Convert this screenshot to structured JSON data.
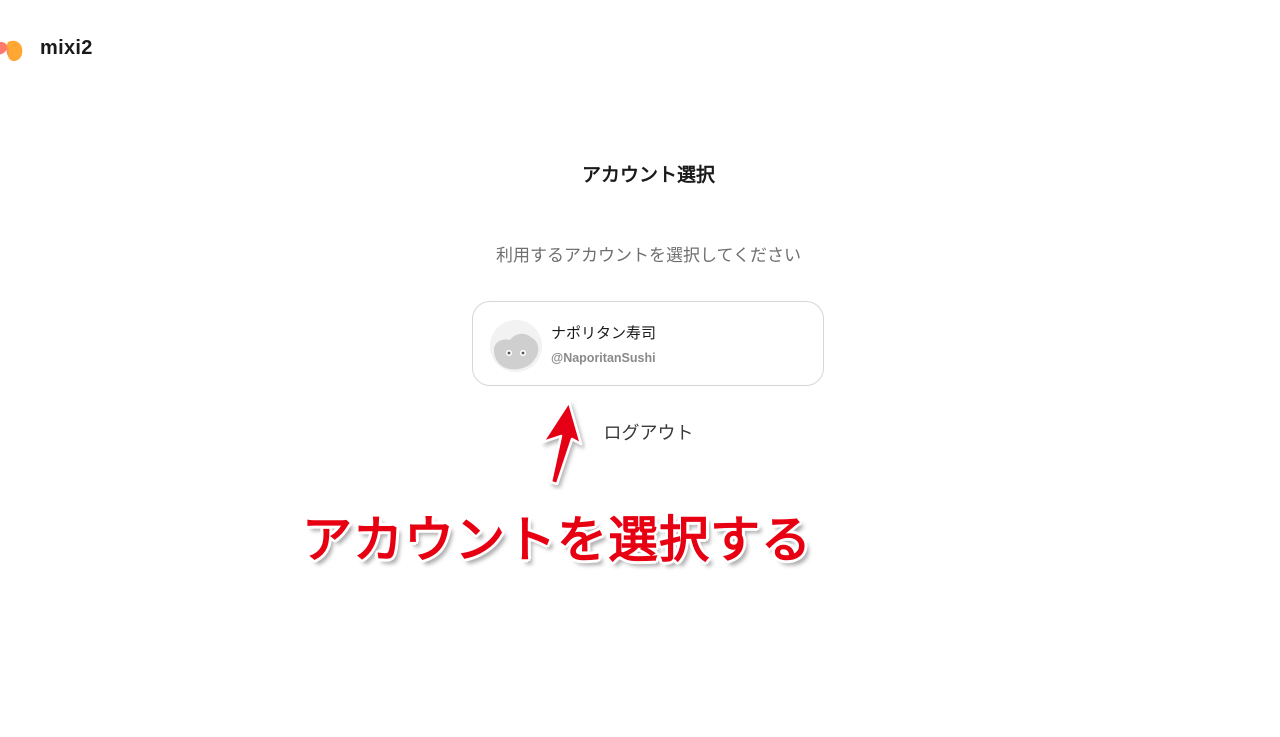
{
  "brand": {
    "name": "mixi2",
    "logo_icon": "mixi2-logo-icon",
    "logo_colors": [
      "#ff6f61",
      "#ffb03a"
    ]
  },
  "page": {
    "title": "アカウント選択",
    "subtitle": "利用するアカウントを選択してください"
  },
  "account": {
    "display_name": "ナポリタン寿司",
    "handle": "@NaporitanSushi",
    "avatar_icon": "default-avatar-icon"
  },
  "logout": {
    "label": "ログアウト"
  },
  "annotation": {
    "text": "アカウントを選択する",
    "color": "#e60012",
    "arrow_icon": "red-arrow-up-icon"
  }
}
